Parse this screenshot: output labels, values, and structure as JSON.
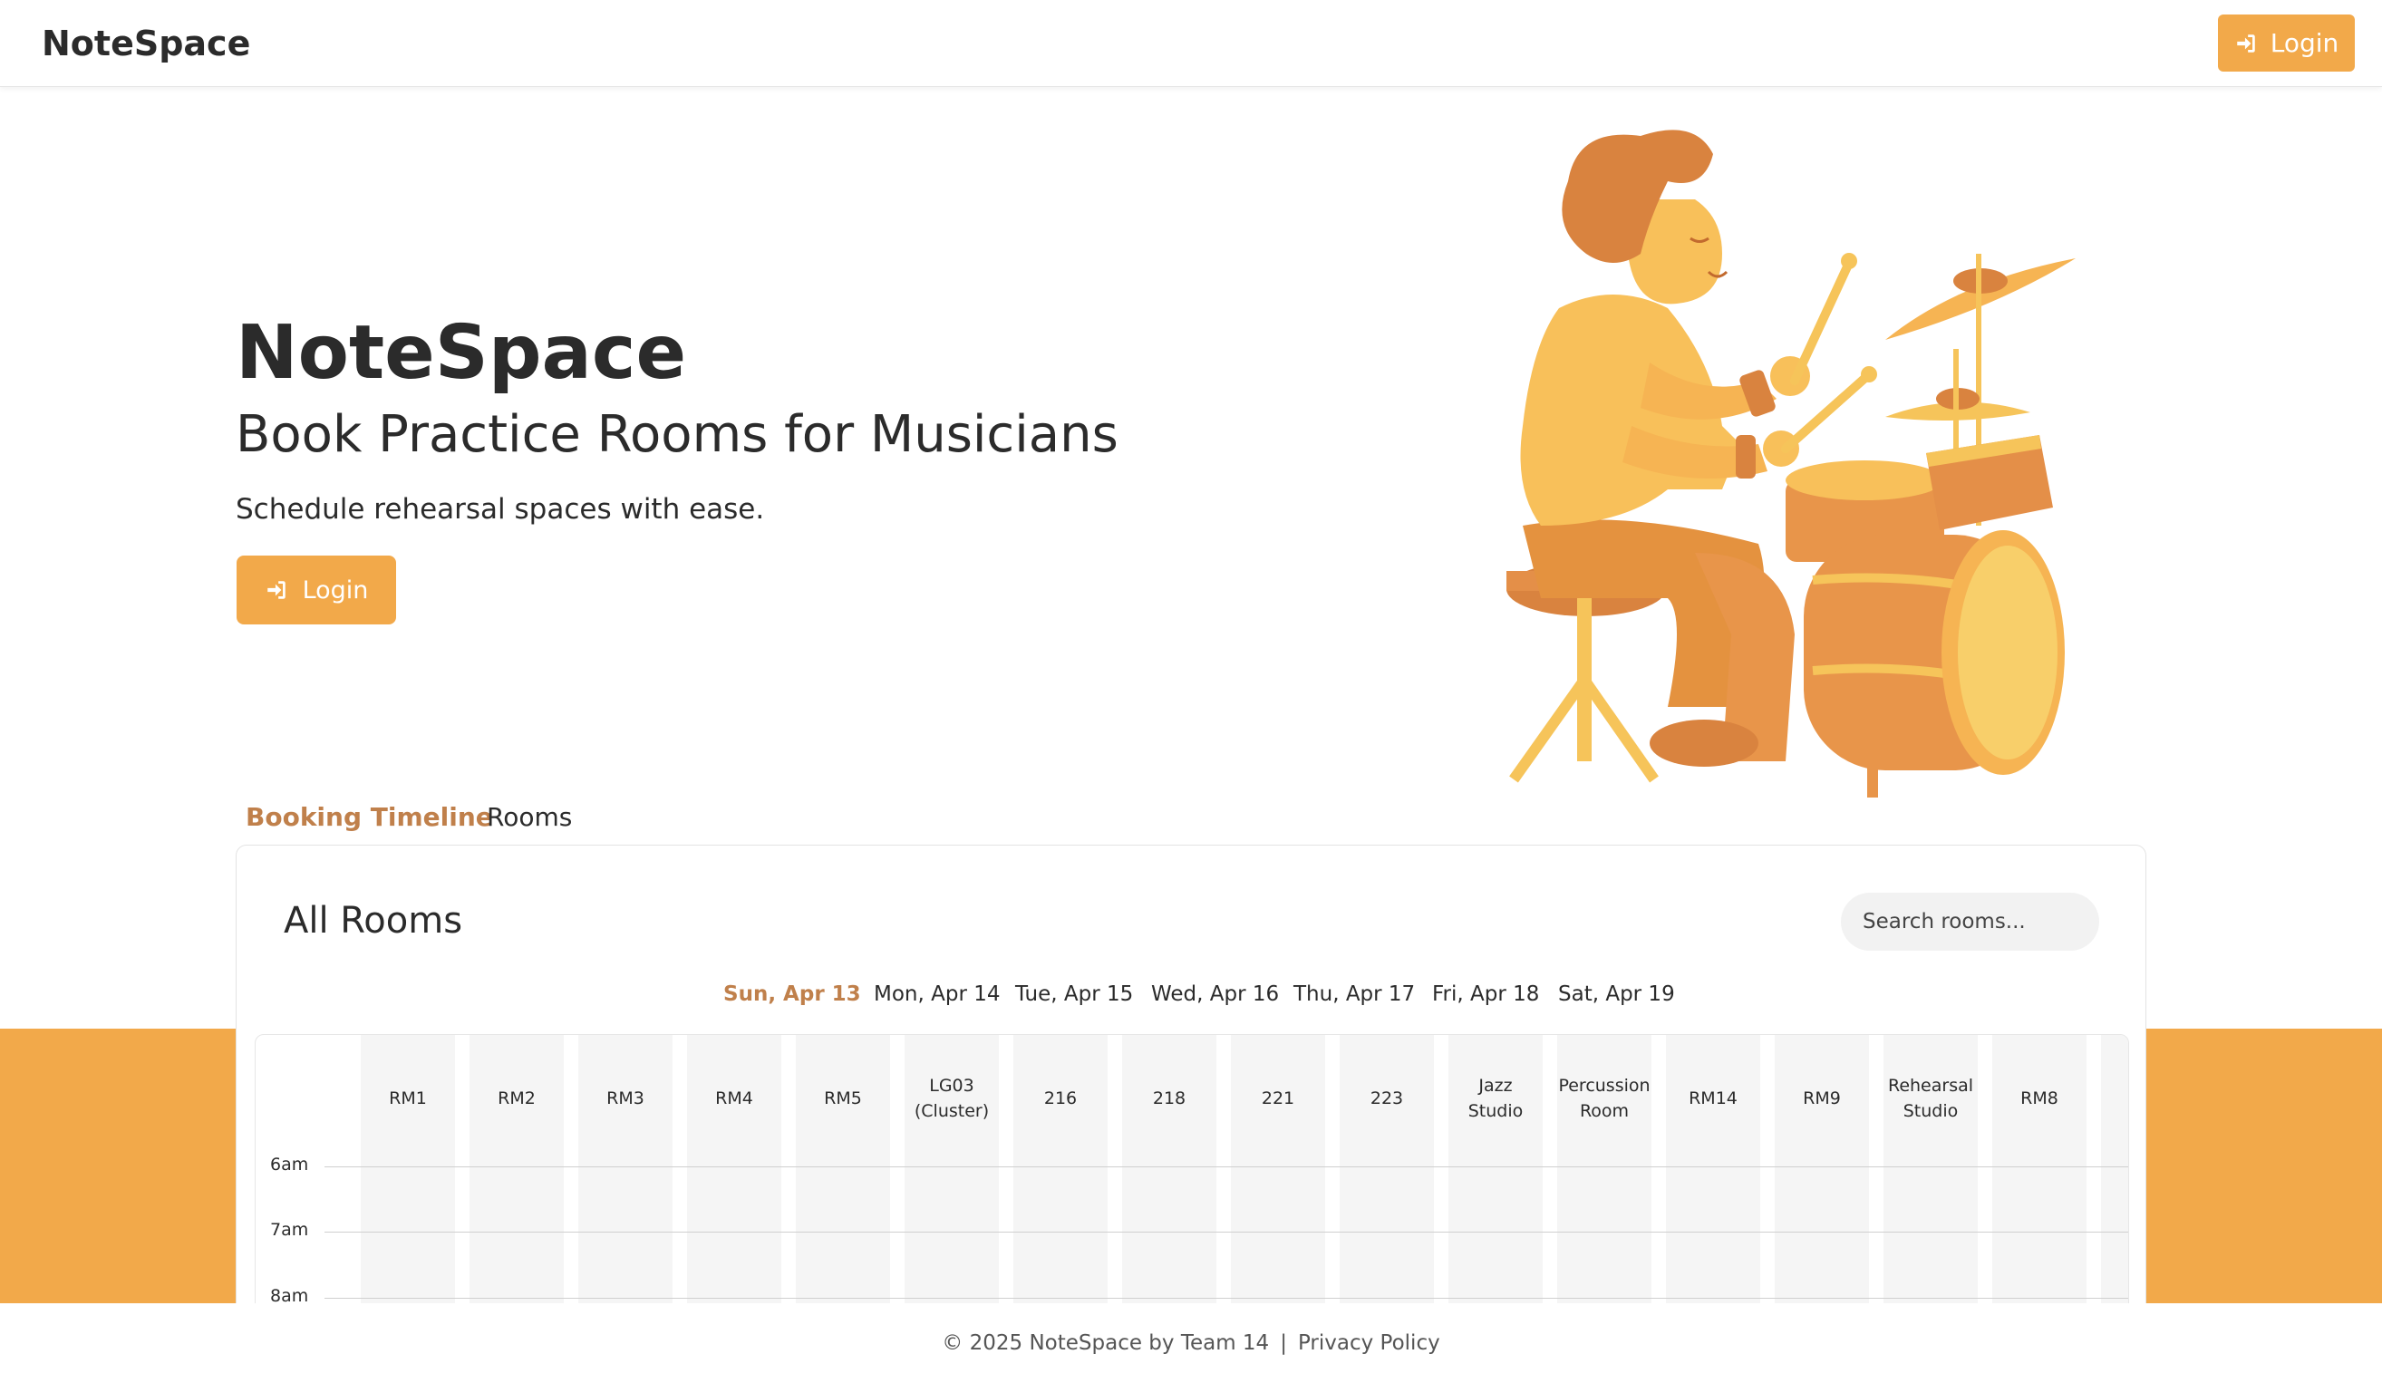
{
  "navbar": {
    "brand": "NoteSpace",
    "login_label": "Login"
  },
  "hero": {
    "title": "NoteSpace",
    "subtitle": "Book Practice Rooms for Musicians",
    "tagline": "Schedule rehearsal spaces with ease.",
    "login_label": "Login"
  },
  "tabs": [
    {
      "label": "Booking Timeline",
      "active": true
    },
    {
      "label": "Rooms",
      "active": false
    }
  ],
  "timeline": {
    "title": "All Rooms",
    "search_placeholder": "Search rooms...",
    "days": [
      {
        "label": "Sun, Apr 13",
        "active": true
      },
      {
        "label": "Mon, Apr 14",
        "active": false
      },
      {
        "label": "Tue, Apr 15",
        "active": false
      },
      {
        "label": "Wed, Apr 16",
        "active": false
      },
      {
        "label": "Thu, Apr 17",
        "active": false
      },
      {
        "label": "Fri, Apr 18",
        "active": false
      },
      {
        "label": "Sat, Apr 19",
        "active": false
      }
    ],
    "rooms": [
      "RM1",
      "RM2",
      "RM3",
      "RM4",
      "RM5",
      "LG03 (Cluster)",
      "216",
      "218",
      "221",
      "223",
      "Jazz Studio",
      "Percussion Room",
      "RM14",
      "RM9",
      "Rehearsal Studio",
      "RM8"
    ],
    "times": [
      "6am",
      "7am",
      "8am"
    ]
  },
  "footer": {
    "copyright": "© 2025 NoteSpace by Team 14",
    "separator": "|",
    "privacy_label": "Privacy Policy"
  },
  "colors": {
    "accent": "#f2a94a",
    "active_text": "#c0804b",
    "text": "#2b2b2b"
  },
  "icons": {
    "login": "sign-in-icon"
  }
}
